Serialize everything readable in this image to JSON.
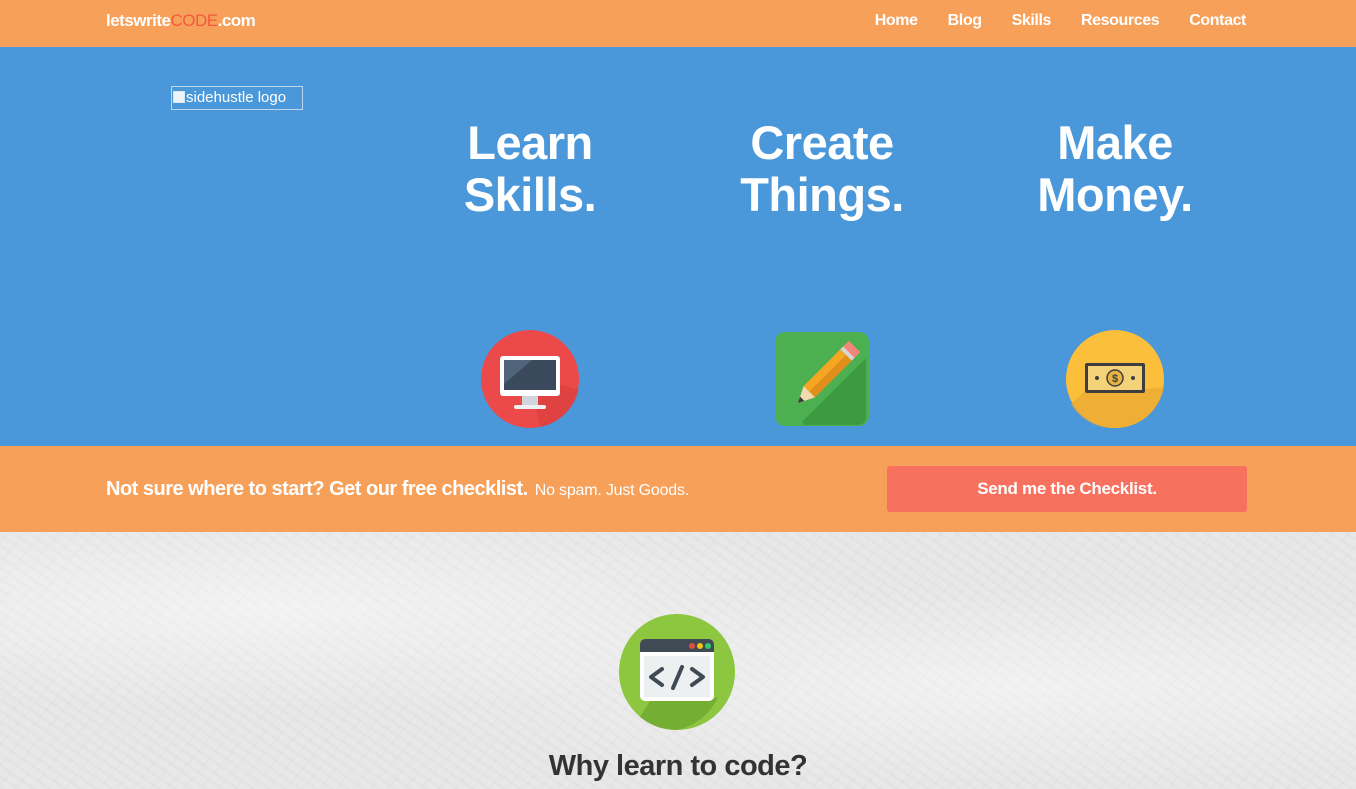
{
  "nav": {
    "brand_prefix": "letswrite",
    "brand_highlight": "CODE",
    "brand_suffix": ".com",
    "links": [
      "Home",
      "Blog",
      "Skills",
      "Resources",
      "Contact"
    ]
  },
  "hero": {
    "logo_alt": "sidehustle logo",
    "columns": [
      {
        "line1": "Learn",
        "line2": "Skills.",
        "icon": "computer-icon"
      },
      {
        "line1": "Create",
        "line2": "Things.",
        "icon": "pencil-icon"
      },
      {
        "line1": "Make",
        "line2": "Money.",
        "icon": "money-icon"
      }
    ]
  },
  "cta": {
    "text": "Not sure where to start? Get our free checklist.",
    "subtext": "No spam. Just Goods.",
    "button": "Send me the Checklist."
  },
  "section": {
    "icon": "code-window-icon",
    "title": "Why learn to code?"
  },
  "colors": {
    "nav_bg": "#f7a05a",
    "hero_bg": "#4a98da",
    "brand_accent": "#f35a3c",
    "button_bg": "#f8705e"
  }
}
